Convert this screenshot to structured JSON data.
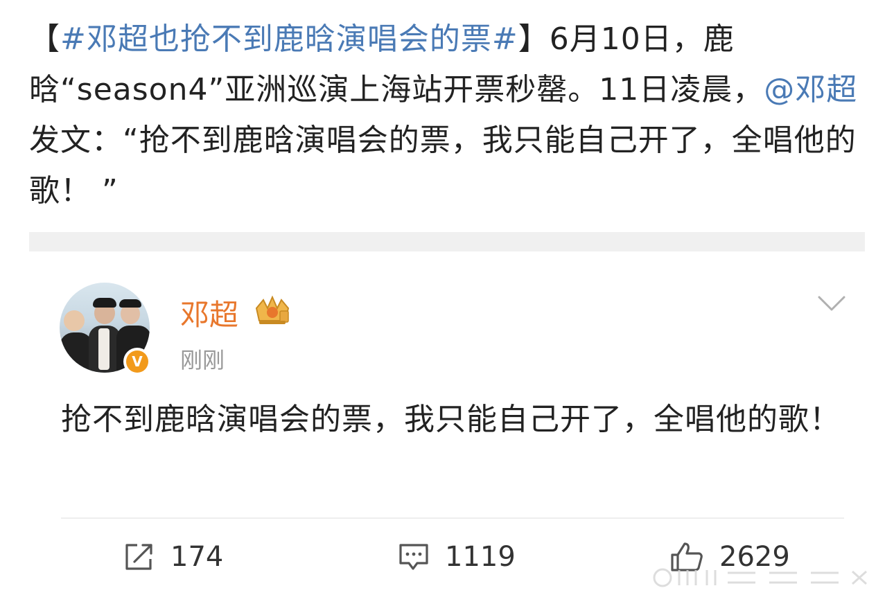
{
  "post": {
    "bracket_open": "【",
    "topic": "#邓超也抢不到鹿晗演唱会的票#",
    "bracket_close": "】",
    "body_before_mention": "6月10日，鹿晗“season4”亚洲巡演上海站开票秒罄。11日凌晨，",
    "mention": "@邓超",
    "body_after_mention": "发文：“抢不到鹿晗演唱会的票，我只能自己开了，全唱他的歌！ ”"
  },
  "quoted_post": {
    "user_name": "邓超",
    "time": "刚刚",
    "verified_badge": "V",
    "text": "抢不到鹿晗演唱会的票，我只能自己开了，全唱他的歌！",
    "actions": {
      "repost_count": "174",
      "comment_count": "1119",
      "like_count": "2629"
    }
  },
  "icons": {
    "repost": "share-box-icon",
    "comment": "comment-bubble-icon",
    "like": "thumbs-up-icon",
    "crown": "crown-badge-icon",
    "menu": "chevron-down-icon"
  },
  "colors": {
    "link": "#4a7ab5",
    "user_name": "#e8772c",
    "verified": "#f29a1b",
    "muted": "#999999"
  }
}
